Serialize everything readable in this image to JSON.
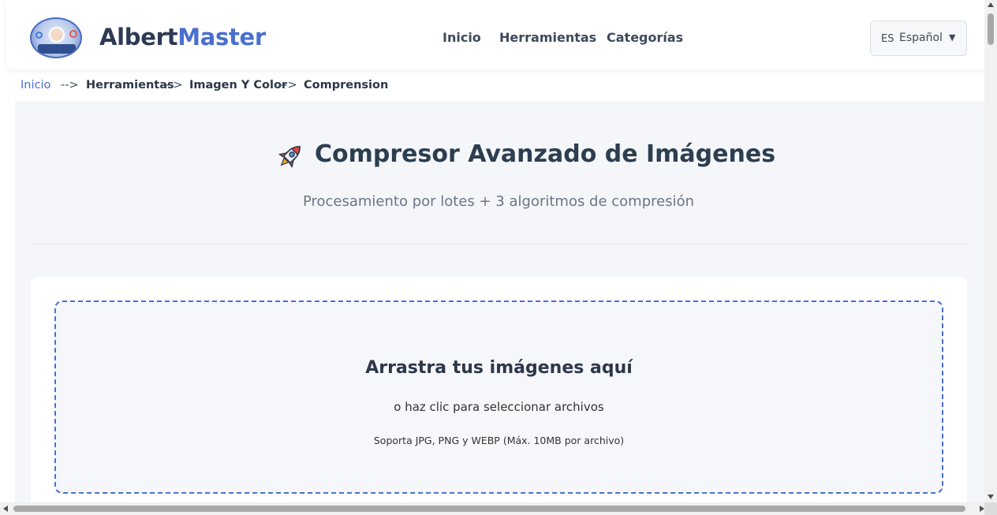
{
  "header": {
    "brand_part1": "Albert",
    "brand_part2": "Master",
    "nav": [
      "Inicio",
      "Herramientas",
      "Categorías"
    ],
    "language": {
      "code": "ES",
      "label": "Español",
      "arrow": "▼"
    }
  },
  "breadcrumb": {
    "items": [
      "Inicio",
      "Herramientas",
      "Imagen Y Color",
      "Comprension"
    ],
    "separator": "-->"
  },
  "main": {
    "title": "Compresor Avanzado de Imágenes",
    "subtitle": "Procesamiento por lotes + 3 algoritmos de compresión",
    "dropzone": {
      "title": "Arrastra tus imágenes aquí",
      "subtitle": "o haz clic para seleccionar archivos",
      "note": "Soporta JPG, PNG y WEBP (Máx. 10MB por archivo)"
    }
  },
  "colors": {
    "accent": "#4a6fd0",
    "brand_dark": "#2d3a55",
    "background": "#f4f6fa"
  },
  "icons": {
    "title_icon": "rocket-icon",
    "logo": "albertmaster-logo"
  }
}
